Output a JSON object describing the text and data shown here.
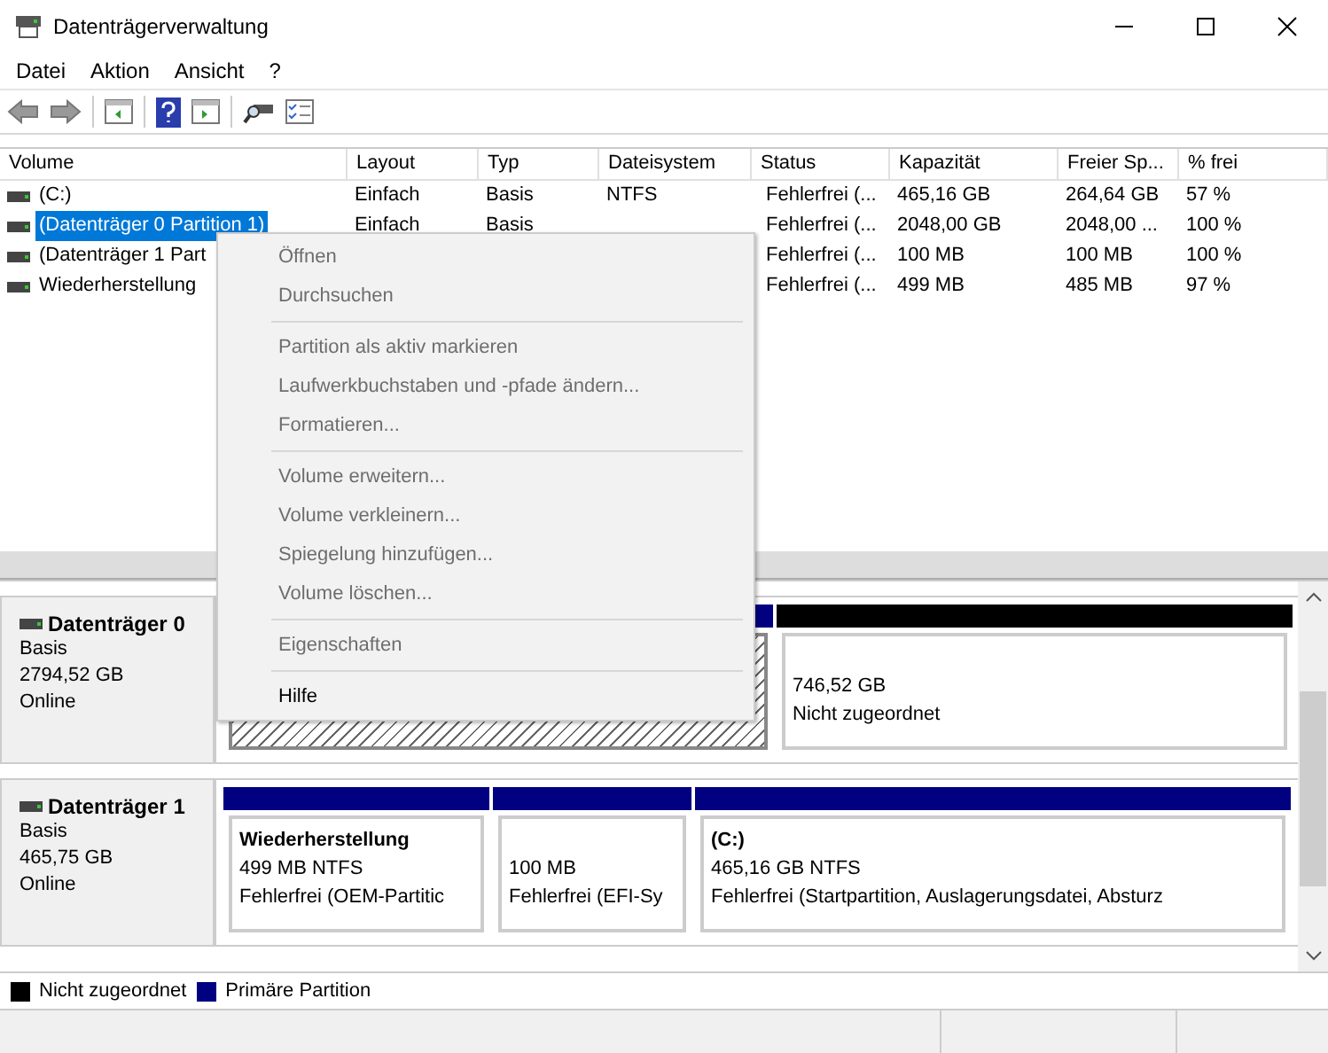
{
  "window": {
    "title": "Datenträgerverwaltung"
  },
  "menu": [
    "Datei",
    "Aktion",
    "Ansicht",
    "?"
  ],
  "table": {
    "columns": [
      "Volume",
      "Layout",
      "Typ",
      "Dateisystem",
      "Status",
      "Kapazität",
      "Freier Sp...",
      "% frei"
    ],
    "rows": [
      {
        "selected": false,
        "cells": [
          "(C:)",
          "Einfach",
          "Basis",
          "NTFS",
          "Fehlerfrei (...",
          "465,16 GB",
          "264,64 GB",
          "57 %"
        ]
      },
      {
        "selected": true,
        "cells": [
          "(Datenträger 0 Partition 1)",
          "Einfach",
          "Basis",
          null,
          "Fehlerfrei (...",
          "2048,00 GB",
          "2048,00 ...",
          "100 %"
        ]
      },
      {
        "selected": false,
        "cells": [
          "(Datenträger 1 Part",
          null,
          null,
          null,
          "Fehlerfrei (...",
          "100 MB",
          "100 MB",
          "100 %"
        ]
      },
      {
        "selected": false,
        "cells": [
          "Wiederherstellung",
          null,
          null,
          null,
          "Fehlerfrei (...",
          "499 MB",
          "485 MB",
          "97 %"
        ]
      }
    ]
  },
  "disks": [
    {
      "name": "Datenträger 0",
      "type": "Basis",
      "size": "2794,52 GB",
      "status": "Online",
      "partitions": [
        {
          "kind": "primary",
          "selected": true
        },
        {
          "kind": "unallocated",
          "selected": false,
          "lines": [
            "746,52 GB",
            "Nicht zugeordnet"
          ]
        }
      ]
    },
    {
      "name": "Datenträger 1",
      "type": "Basis",
      "size": "465,75 GB",
      "status": "Online",
      "partitions": [
        {
          "kind": "primary",
          "selected": false,
          "title": "Wiederherstellung",
          "lines": [
            "499 MB NTFS",
            "Fehlerfrei (OEM-Partitic"
          ]
        },
        {
          "kind": "primary",
          "selected": false,
          "lines": [
            "100 MB",
            "Fehlerfrei (EFI-Sy"
          ]
        },
        {
          "kind": "primary",
          "selected": false,
          "title": "(C:)",
          "lines": [
            "465,16 GB NTFS",
            "Fehlerfrei (Startpartition, Auslagerungsdatei, Absturz"
          ]
        }
      ]
    }
  ],
  "legend": [
    {
      "label": "Nicht zugeordnet",
      "color": "#000000"
    },
    {
      "label": "Primäre Partition",
      "color": "#000080"
    }
  ],
  "context_menu": [
    {
      "kind": "item",
      "label": "Öffnen",
      "disabled": true
    },
    {
      "kind": "item",
      "label": "Durchsuchen",
      "disabled": true
    },
    {
      "kind": "separator"
    },
    {
      "kind": "item",
      "label": "Partition als aktiv markieren",
      "disabled": true
    },
    {
      "kind": "item",
      "label": "Laufwerkbuchstaben und -pfade ändern...",
      "disabled": true
    },
    {
      "kind": "item",
      "label": "Formatieren...",
      "disabled": true
    },
    {
      "kind": "separator"
    },
    {
      "kind": "item",
      "label": "Volume erweitern...",
      "disabled": true
    },
    {
      "kind": "item",
      "label": "Volume verkleinern...",
      "disabled": true
    },
    {
      "kind": "item",
      "label": "Spiegelung hinzufügen...",
      "disabled": true
    },
    {
      "kind": "item",
      "label": "Volume löschen...",
      "disabled": true
    },
    {
      "kind": "separator"
    },
    {
      "kind": "item",
      "label": "Eigenschaften",
      "disabled": true
    },
    {
      "kind": "separator"
    },
    {
      "kind": "item",
      "label": "Hilfe",
      "disabled": false
    }
  ]
}
